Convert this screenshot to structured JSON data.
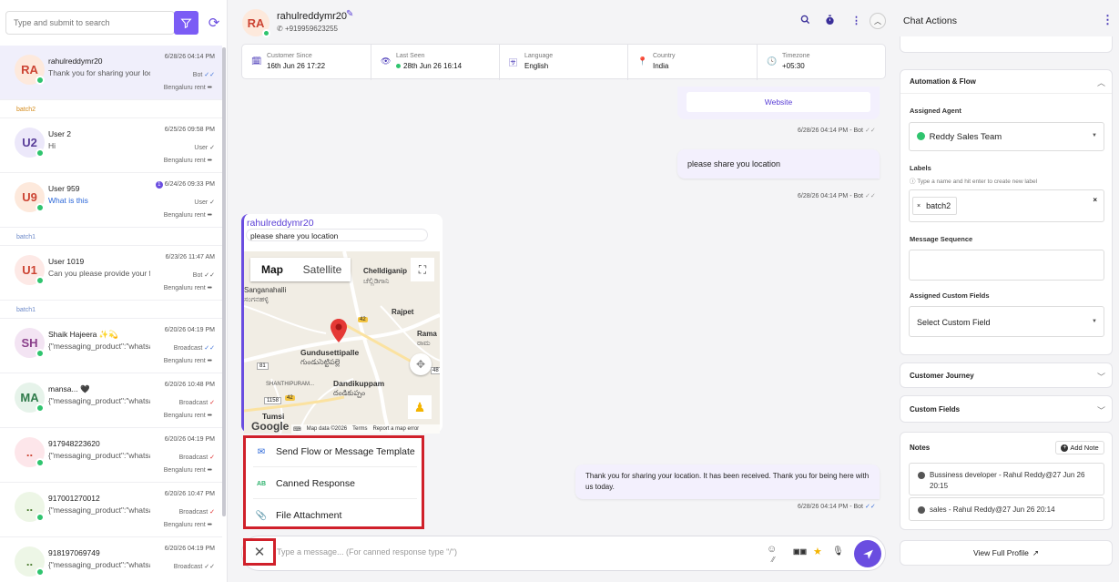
{
  "left": {
    "search_placeholder": "Type and submit to search",
    "chats": [
      {
        "initials": "RA",
        "name": "rahulreddymr20",
        "preview": "Thank you for sharing your loc",
        "time": "6/28/26 04:14 PM",
        "source": "Bot",
        "tick": "✓✓",
        "tick_color": "blue",
        "location": "Bengaluru rent",
        "bg": "#fde9dc",
        "fg": "#c43",
        "active": true
      },
      {
        "batch": "batch2",
        "batch_color": "orange"
      },
      {
        "initials": "U2",
        "name": "User 2",
        "preview": "Hi",
        "time": "6/25/26 09:58 PM",
        "source": "User",
        "tick": "✓",
        "tick_color": "gray",
        "location": "Bengaluru rent",
        "bg": "#ece8fa",
        "fg": "#5a3f9a"
      },
      {
        "initials": "U9",
        "name": "User 959",
        "preview": "What is this",
        "preview_blue": true,
        "unread": "1",
        "time": "6/24/26 09:33 PM",
        "source": "User",
        "tick": "✓",
        "tick_color": "gray",
        "location": "Bengaluru rent",
        "bg": "#fde9dc",
        "fg": "#c43"
      },
      {
        "batch": "batch1"
      },
      {
        "initials": "U1",
        "name": "User 1019",
        "preview": "Can you please provide your fu",
        "time": "6/23/26 11:47 AM",
        "source": "Bot",
        "tick": "✓✓",
        "tick_color": "gray",
        "location": "Bengaluru rent",
        "bg": "#fde9e6",
        "fg": "#c43"
      },
      {
        "batch": "batch1"
      },
      {
        "initials": "SH",
        "name": "Shaik Hajeera ✨💫",
        "preview": "{\"messaging_product\":\"whatsapp",
        "time": "6/20/26 04:19 PM",
        "source": "Broadcast",
        "tick": "✓✓",
        "tick_color": "blue",
        "location": "Bengaluru rent",
        "bg": "#f3e4f3",
        "fg": "#8a3f8a"
      },
      {
        "initials": "MA",
        "name": "mansa... 🖤",
        "preview": "{\"messaging_product\":\"whatsapp",
        "time": "6/20/26 10:48 PM",
        "source": "Broadcast",
        "tick": "✓",
        "tick_color": "red",
        "location": "Bengaluru rent",
        "bg": "#e6f3ea",
        "fg": "#2f7a4a"
      },
      {
        "initials": "..",
        "name": "917948223620",
        "preview": "{\"messaging_product\":\"whatsapp",
        "time": "6/20/26 04:19 PM",
        "source": "Broadcast",
        "tick": "✓",
        "tick_color": "red",
        "location": "Bengaluru rent",
        "bg": "#fde6ea",
        "fg": "#c43"
      },
      {
        "initials": "..",
        "name": "917001270012",
        "preview": "{\"messaging_product\":\"whatsapp",
        "time": "6/20/26 10:47 PM",
        "source": "Broadcast",
        "tick": "✓",
        "tick_color": "red",
        "location": "Bengaluru rent",
        "bg": "#edf6e6",
        "fg": "#4a7a2f"
      },
      {
        "initials": "..",
        "name": "918197069749",
        "preview": "{\"messaging_product\":\"whatsapp",
        "time": "6/20/26 04:19 PM",
        "source": "Broadcast",
        "tick": "✓✓",
        "tick_color": "gray",
        "location": "",
        "bg": "#edf6e6",
        "fg": "#4a7a2f"
      }
    ]
  },
  "header": {
    "initials": "RA",
    "name": "rahulreddymr20",
    "phone": "+919959623255",
    "info": [
      {
        "label": "Customer Since",
        "value": "16th Jun 26 17:22",
        "icon": "🗓"
      },
      {
        "label": "Last Seen",
        "value": "28th Jun 26 16:14",
        "icon": "👁",
        "online": true
      },
      {
        "label": "Language",
        "value": "English",
        "icon": "🈂"
      },
      {
        "label": "Country",
        "value": "India",
        "icon": "📍"
      },
      {
        "label": "Timezone",
        "value": "+05:30",
        "icon": "🕓"
      }
    ]
  },
  "messages": {
    "website_button": "Website",
    "meta1": "6/28/26 04:14 PM - Bot",
    "msg2": "please share you location",
    "meta2": "6/28/26 04:14 PM - Bot",
    "quote_author": "rahulreddymr20",
    "quote_text": "please share you location",
    "msg3": "Thank you for sharing your location. It has been received. Thank you for being here with us today.",
    "meta3": "6/28/26 04:14 PM - Bot"
  },
  "map": {
    "tab_map": "Map",
    "tab_satellite": "Satellite",
    "places": {
      "chelding": "Chelldiganip",
      "chelding_kn": "ಚೆಲ್ಲಿಡಿಗಾನಿ",
      "sangana": "Sanganahalli",
      "sangana_kn": "ಸಂಗನಹಳ್ಳಿ",
      "rajpet": "Rajpet",
      "rama": "Rama",
      "rama_kn": "ರಾಮ",
      "gundu": "Gundusettipalle",
      "gundu_kn": "గుండుసెట్టిపల్లె",
      "shanti": "SHANTHIPURAM...",
      "dandi": "Dandikuppam",
      "dandi_kn": "దండికుప్పం",
      "tumsi": "Tumsi"
    },
    "roads": {
      "r42a": "42",
      "r81": "81",
      "r42b": "42",
      "r1158": "1158",
      "r48": "48"
    },
    "google": "Google",
    "attribution": "Map data ©2026",
    "terms": "Terms",
    "report": "Report a map error"
  },
  "popup": {
    "items": [
      {
        "label": "Send Flow or Message Template",
        "icon": "✉"
      },
      {
        "label": "Canned Response",
        "icon": "AB"
      },
      {
        "label": "File Attachment",
        "icon": "📎"
      }
    ]
  },
  "input": {
    "placeholder": "Type a message... (For canned response type \"/\")"
  },
  "right": {
    "title": "Chat Actions",
    "automation_title": "Automation & Flow",
    "assigned_agent_label": "Assigned Agent",
    "assigned_agent_value": "Reddy Sales Team",
    "labels_label": "Labels",
    "labels_hint": "Type a name and hit enter to create new label",
    "label_tag": "batch2",
    "message_sequence_label": "Message Sequence",
    "custom_fields_label": "Assigned Custom Fields",
    "custom_fields_value": "Select Custom Field",
    "customer_journey": "Customer Journey",
    "custom_fields": "Custom Fields",
    "notes_title": "Notes",
    "add_note": "Add Note",
    "notes": [
      "Bussiness developer - Rahul Reddy@27 Jun 26 20:15",
      "sales - Rahul Reddy@27 Jun 26 20:14"
    ],
    "view_profile": "View Full Profile"
  },
  "colors": {
    "accent": "#6a4de0",
    "highlight": "#d0202a",
    "online": "#2fc46e"
  }
}
